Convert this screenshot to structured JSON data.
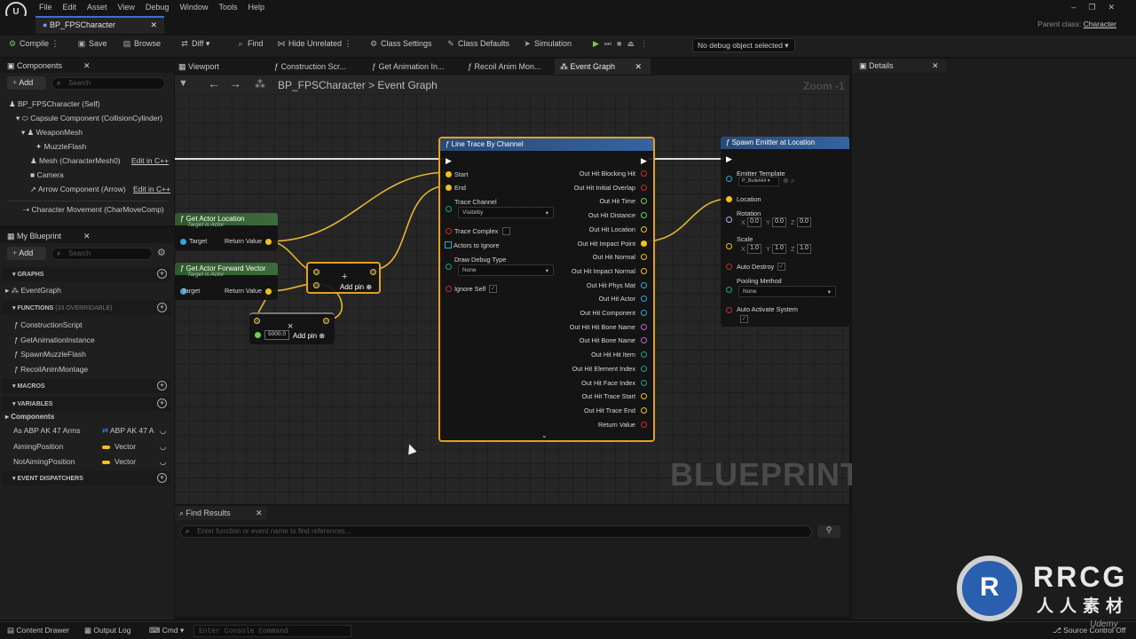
{
  "menu": [
    "File",
    "Edit",
    "Asset",
    "View",
    "Debug",
    "Window",
    "Tools",
    "Help"
  ],
  "asset_tab": "BP_FPSCharacter",
  "parent_class": {
    "label": "Parent class:",
    "value": "Character"
  },
  "toolbar": {
    "compile": "Compile",
    "save": "Save",
    "browse": "Browse",
    "diff": "Diff",
    "find": "Find",
    "hide_unrelated": "Hide Unrelated",
    "class_settings": "Class Settings",
    "class_defaults": "Class Defaults",
    "simulation": "Simulation",
    "debug_object": "No debug object selected"
  },
  "components": {
    "title": "Components",
    "add": "Add",
    "search": "Search",
    "items": [
      "BP_FPSCharacter (Self)",
      "Capsule Component (CollisionCylinder)",
      "WeaponMesh",
      "MuzzleFlash",
      "Mesh (CharacterMesh0)",
      "Camera",
      "Arrow Component (Arrow)",
      "Character Movement (CharMoveComp)"
    ],
    "edit_cpp": "Edit in C++"
  },
  "my_blueprint": {
    "title": "My Blueprint",
    "add": "Add",
    "search": "Search",
    "graphs": "GRAPHS",
    "event_graph": "EventGraph",
    "functions": "FUNCTIONS",
    "functions_note": "(33 OVERRIDABLE)",
    "function_items": [
      "ConstructionScript",
      "GetAnimationInstance",
      "SpawnMuzzleFlash",
      "RecoilAnimMontage"
    ],
    "macros": "MACROS",
    "variables": "VARIABLES",
    "components_cat": "Components",
    "vars": [
      {
        "name": "As ABP AK 47 Arms",
        "type": "ABP AK 47 A",
        "color": "#3a7bd5"
      },
      {
        "name": "AimingPosition",
        "type": "Vector",
        "color": "#f0c020"
      },
      {
        "name": "NotAimingPosition",
        "type": "Vector",
        "color": "#f0c020"
      }
    ],
    "dispatchers": "EVENT DISPATCHERS"
  },
  "doc_tabs": [
    "Viewport",
    "Construction Scr...",
    "Get Animation In...",
    "Recoil Anim Mon...",
    "Event Graph"
  ],
  "details": {
    "title": "Details"
  },
  "breadcrumb": {
    "root": "BP_FPSCharacter",
    "sep": ">",
    "current": "Event Graph"
  },
  "zoom": "Zoom -1",
  "nodes": {
    "get_actor_location": {
      "title": "Get Actor Location",
      "subtitle": "Target is Actor",
      "target": "Target",
      "ret": "Return Value"
    },
    "get_actor_forward": {
      "title": "Get Actor Forward Vector",
      "subtitle": "Target is Actor",
      "target": "Target",
      "ret": "Return Value"
    },
    "add1": {
      "label": "Add pin",
      "plus": "+"
    },
    "mul": {
      "value": "5000.0",
      "label": "Add pin",
      "times": "×"
    },
    "line_trace": {
      "title": "Line Trace By Channel",
      "start": "Start",
      "end": "End",
      "trace_channel": "Trace Channel",
      "trace_channel_value": "Visibility",
      "trace_complex": "Trace Complex",
      "actors_ignore": "Actors to Ignore",
      "draw_debug": "Draw Debug Type",
      "draw_debug_value": "None",
      "ignore_self": "Ignore Self",
      "outputs": [
        "Out Hit Blocking Hit",
        "Out Hit Initial Overlap",
        "Out Hit Time",
        "Out Hit Distance",
        "Out Hit Location",
        "Out Hit Impact Point",
        "Out Hit Normal",
        "Out Hit Impact Normal",
        "Out Hit Phys Mat",
        "Out Hit Actor",
        "Out Hit Component",
        "Out Hit Hit Bone Name",
        "Out Hit Bone Name",
        "Out Hit Hit Item",
        "Out Hit Element Index",
        "Out Hit Face Index",
        "Out Hit Trace Start",
        "Out Hit Trace End",
        "Return Value"
      ]
    },
    "spawn_emitter": {
      "title": "Spawn Emitter at Location",
      "emitter_template": "Emitter Template",
      "emitter_value": "P_BulletHit",
      "location": "Location",
      "rotation": "Rotation",
      "rot": [
        "0.0",
        "0.0",
        "0.0"
      ],
      "scale": "Scale",
      "scl": [
        "1.0",
        "1.0",
        "1.0"
      ],
      "xyz": [
        "X",
        "Y",
        "Z"
      ],
      "auto_destroy": "Auto Destroy",
      "pooling": "Pooling Method",
      "pooling_value": "None",
      "auto_activate": "Auto Activate System"
    }
  },
  "watermark": "BLUEPRINT",
  "find_results": {
    "title": "Find Results",
    "placeholder": "Enter function or event name to find references..."
  },
  "statusbar": {
    "content_drawer": "Content Drawer",
    "output_log": "Output Log",
    "cmd": "Cmd",
    "console_placeholder": "Enter Console Command",
    "source_control": "Source Control Off"
  },
  "brand": {
    "name": "RRCG",
    "sub": "人人素材",
    "udemy": "Udemy"
  }
}
